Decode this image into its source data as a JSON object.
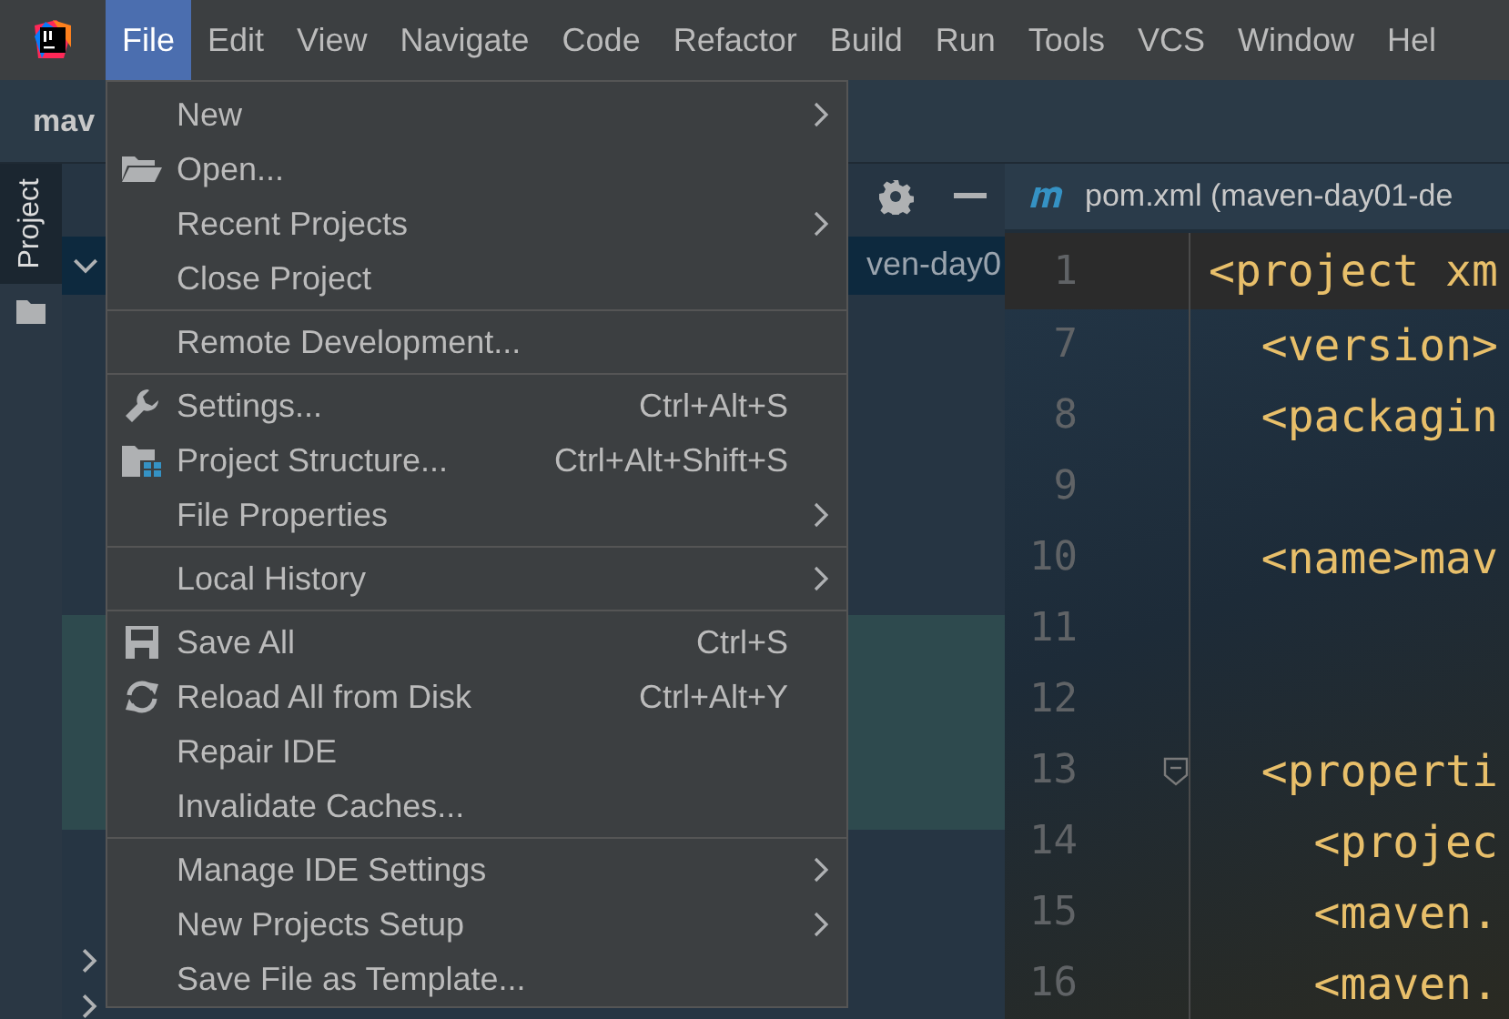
{
  "menu_bar": [
    {
      "label": "File",
      "selected": true
    },
    {
      "label": "Edit",
      "selected": false
    },
    {
      "label": "View",
      "selected": false
    },
    {
      "label": "Navigate",
      "selected": false
    },
    {
      "label": "Code",
      "selected": false
    },
    {
      "label": "Refactor",
      "selected": false
    },
    {
      "label": "Build",
      "selected": false
    },
    {
      "label": "Run",
      "selected": false
    },
    {
      "label": "Tools",
      "selected": false
    },
    {
      "label": "VCS",
      "selected": false
    },
    {
      "label": "Window",
      "selected": false
    },
    {
      "label": "Hel",
      "selected": false
    }
  ],
  "breadcrumb": "mav",
  "tool_stripe": {
    "label": "Project",
    "selected": true
  },
  "project_panel": {
    "tree_row": {
      "label": "ven-day0",
      "selected": true,
      "expanded": true
    },
    "collapsed_rows": [
      {
        "expanded": false
      },
      {
        "expanded": false
      }
    ]
  },
  "editor": {
    "tab": {
      "label": "pom.xml (maven-day01-de"
    },
    "lines": [
      {
        "number": "1",
        "code": "<project xm",
        "current": true
      },
      {
        "number": "7",
        "code": "  <version>",
        "current": false
      },
      {
        "number": "8",
        "code": "  <packagin",
        "current": false
      },
      {
        "number": "9",
        "current": false
      },
      {
        "number": "10",
        "code": "  <name>mav",
        "current": false
      },
      {
        "number": "11",
        "current": false
      },
      {
        "number": "12",
        "current": false
      },
      {
        "number": "13",
        "code": "  <properti",
        "current": false,
        "foldable": true
      },
      {
        "number": "14",
        "code": "    <projec",
        "current": false
      },
      {
        "number": "15",
        "code": "    <maven.",
        "current": false
      },
      {
        "number": "16",
        "code": "    <maven.",
        "current": false
      }
    ]
  },
  "file_menu": {
    "groups": [
      [
        {
          "label": "New",
          "submenu": true
        },
        {
          "label": "Open...",
          "submenu": false
        },
        {
          "label": "Recent Projects",
          "submenu": true
        },
        {
          "label": "Close Project",
          "submenu": false
        }
      ],
      [
        {
          "label": "Remote Development...",
          "submenu": false
        }
      ],
      [
        {
          "label": "Settings...",
          "shortcut": "Ctrl+Alt+S",
          "submenu": false
        },
        {
          "label": "Project Structure...",
          "shortcut": "Ctrl+Alt+Shift+S",
          "submenu": false
        },
        {
          "label": "File Properties",
          "submenu": true
        }
      ],
      [
        {
          "label": "Local History",
          "submenu": true
        }
      ],
      [
        {
          "label": "Save All",
          "shortcut": "Ctrl+S",
          "submenu": false
        },
        {
          "label": "Reload All from Disk",
          "shortcut": "Ctrl+Alt+Y",
          "submenu": false
        },
        {
          "label": "Repair IDE",
          "submenu": false
        },
        {
          "label": "Invalidate Caches...",
          "submenu": false
        }
      ],
      [
        {
          "label": "Manage IDE Settings",
          "submenu": true
        },
        {
          "label": "New Projects Setup",
          "submenu": true
        },
        {
          "label": "Save File as Template...",
          "submenu": false
        }
      ]
    ]
  }
}
